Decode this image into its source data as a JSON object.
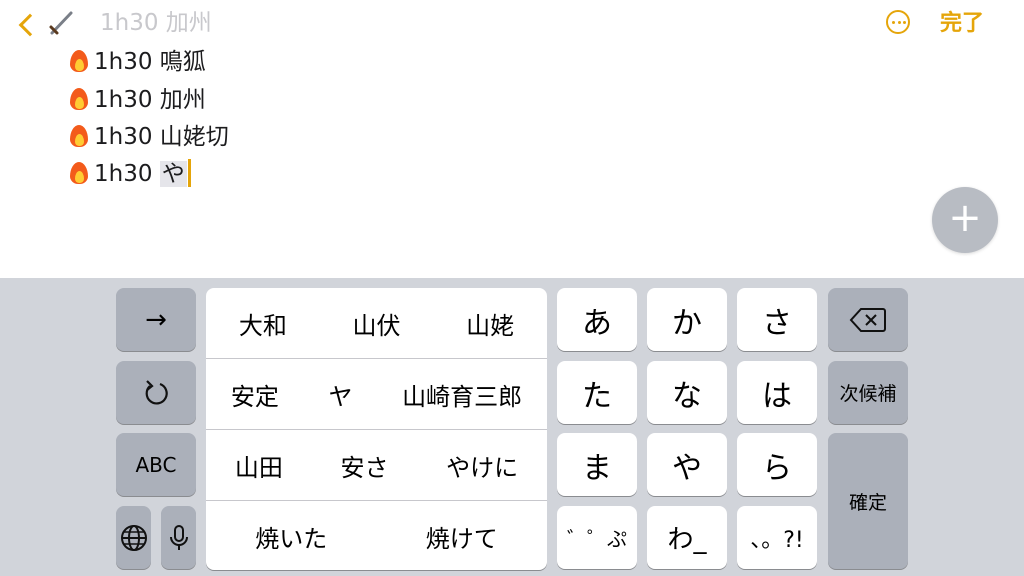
{
  "topbar": {
    "done_label": "完了"
  },
  "note": {
    "lines": [
      {
        "text": "1h30 加州",
        "faded": true
      },
      {
        "text": "1h30 鳴狐"
      },
      {
        "text": "1h30 加州"
      },
      {
        "text": "1h30 山姥切"
      },
      {
        "prefix": "1h30 ",
        "composing": "や"
      }
    ]
  },
  "keyboard": {
    "arrow_key": "→",
    "undo_key": "↺",
    "abc_key": "ABC",
    "globe_key": "globe-icon",
    "mic_key": "mic-icon",
    "candidates": [
      [
        "大和",
        "山伏",
        "山姥"
      ],
      [
        "安定",
        "ヤ",
        "山崎育三郎"
      ],
      [
        "山田",
        "安さ",
        "やけに"
      ],
      [
        "焼いた",
        "焼けて"
      ]
    ],
    "kana_rows": [
      [
        "あ",
        "か",
        "さ"
      ],
      [
        "た",
        "な",
        "は"
      ],
      [
        "ま",
        "や",
        "ら"
      ],
      [
        "゛゜ぷ",
        "わ_",
        "、。?!"
      ]
    ],
    "next_candidate": "次候補",
    "confirm": "確定"
  },
  "colors": {
    "accent": "#e5a50a",
    "keyboard_bg": "#d1d4da",
    "dark_key": "#abb0ba",
    "light_key": "#ffffff"
  }
}
